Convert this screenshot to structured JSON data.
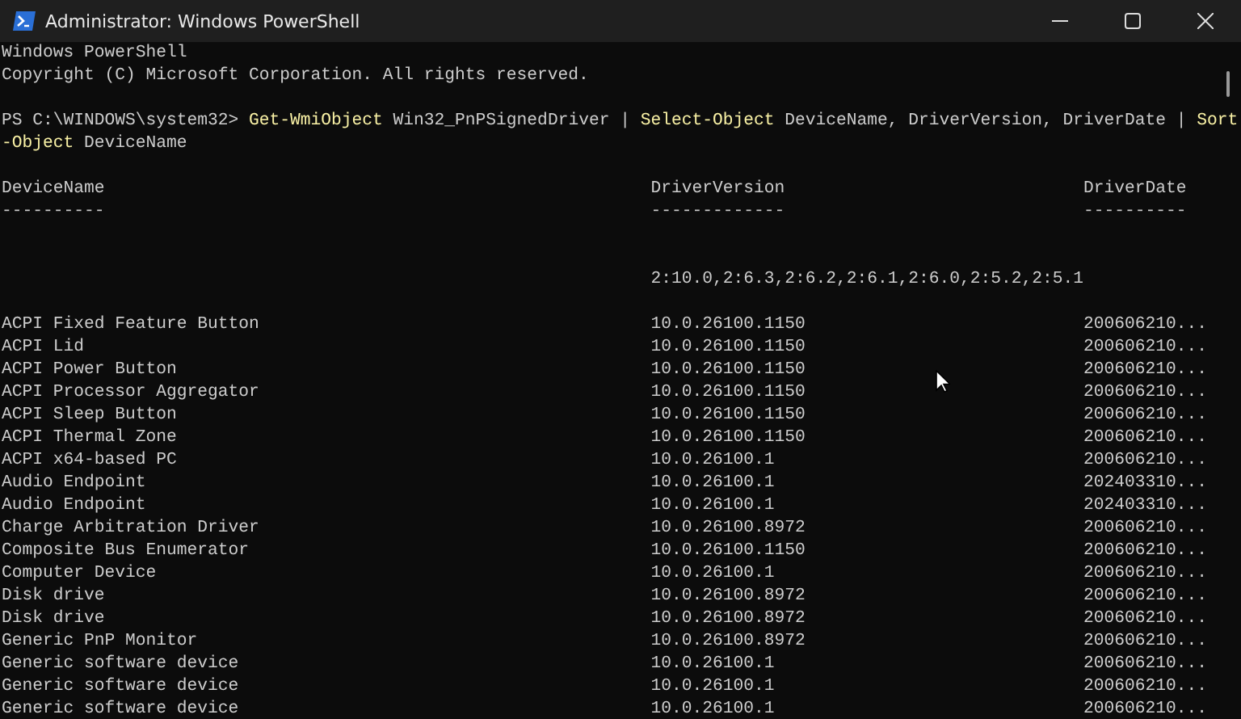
{
  "window": {
    "title": "Administrator: Windows PowerShell"
  },
  "banner": [
    "Windows PowerShell",
    "Copyright (C) Microsoft Corporation. All rights reserved."
  ],
  "command": {
    "prompt": "PS C:\\WINDOWS\\system32> ",
    "tokens": [
      {
        "kind": "cmdlet",
        "text": "Get-WmiObject"
      },
      {
        "kind": "arg",
        "text": " Win32_PnPSignedDriver | "
      },
      {
        "kind": "cmdlet",
        "text": "Select-Object"
      },
      {
        "kind": "arg",
        "text": " DeviceName, DriverVersion, DriverDate | "
      },
      {
        "kind": "cmdlet",
        "text": "Sort-Object"
      },
      {
        "kind": "arg",
        "text": " DeviceName"
      }
    ]
  },
  "table": {
    "columns": [
      {
        "name": "DeviceName",
        "underline": "----------"
      },
      {
        "name": "DriverVersion",
        "underline": "-------------"
      },
      {
        "name": "DriverDate",
        "underline": "----------"
      }
    ],
    "rows": [
      {
        "driver_version": "2:10.0,2:6.3,2:6.2,2:6.1,2:6.0,2:5.2,2:5.1"
      },
      {
        "device_name": "ACPI Fixed Feature Button",
        "driver_version": "10.0.26100.1150",
        "driver_date": "200606210..."
      },
      {
        "device_name": "ACPI Lid",
        "driver_version": "10.0.26100.1150",
        "driver_date": "200606210..."
      },
      {
        "device_name": "ACPI Power Button",
        "driver_version": "10.0.26100.1150",
        "driver_date": "200606210..."
      },
      {
        "device_name": "ACPI Processor Aggregator",
        "driver_version": "10.0.26100.1150",
        "driver_date": "200606210..."
      },
      {
        "device_name": "ACPI Sleep Button",
        "driver_version": "10.0.26100.1150",
        "driver_date": "200606210..."
      },
      {
        "device_name": "ACPI Thermal Zone",
        "driver_version": "10.0.26100.1150",
        "driver_date": "200606210..."
      },
      {
        "device_name": "ACPI x64-based PC",
        "driver_version": "10.0.26100.1",
        "driver_date": "200606210..."
      },
      {
        "device_name": "Audio Endpoint",
        "driver_version": "10.0.26100.1",
        "driver_date": "202403310..."
      },
      {
        "device_name": "Audio Endpoint",
        "driver_version": "10.0.26100.1",
        "driver_date": "202403310..."
      },
      {
        "device_name": "Charge Arbitration Driver",
        "driver_version": "10.0.26100.8972",
        "driver_date": "200606210..."
      },
      {
        "device_name": "Composite Bus Enumerator",
        "driver_version": "10.0.26100.1150",
        "driver_date": "200606210..."
      },
      {
        "device_name": "Computer Device",
        "driver_version": "10.0.26100.1",
        "driver_date": "200606210..."
      },
      {
        "device_name": "Disk drive",
        "driver_version": "10.0.26100.8972",
        "driver_date": "200606210..."
      },
      {
        "device_name": "Disk drive",
        "driver_version": "10.0.26100.8972",
        "driver_date": "200606210..."
      },
      {
        "device_name": "Generic PnP Monitor",
        "driver_version": "10.0.26100.8972",
        "driver_date": "200606210..."
      },
      {
        "device_name": "Generic software device",
        "driver_version": "10.0.26100.1",
        "driver_date": "200606210..."
      },
      {
        "device_name": "Generic software device",
        "driver_version": "10.0.26100.1",
        "driver_date": "200606210..."
      },
      {
        "device_name": "Generic software device",
        "driver_version": "10.0.26100.1",
        "driver_date": "200606210..."
      }
    ]
  }
}
